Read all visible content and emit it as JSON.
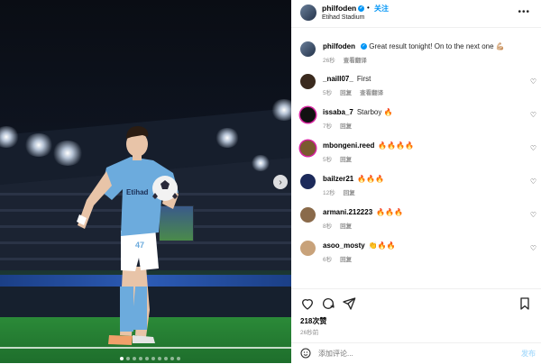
{
  "header": {
    "username": "philfoden",
    "separator": "•",
    "follow_label": "关注",
    "location": "Etihad Stadium",
    "more_icon": "more-dots-icon"
  },
  "caption": {
    "username": "philfoden",
    "text": "Great result tonight! On to the next one 💪🏼",
    "time": "26秒",
    "translate_label": "查看翻译"
  },
  "comments": [
    {
      "username": "_naill07_",
      "text": "First",
      "time": "5秒",
      "reply_label": "回复",
      "translate_label": "查看翻译"
    },
    {
      "username": "issaba_7",
      "text": "Starboy 🔥",
      "time": "7秒",
      "reply_label": "回复"
    },
    {
      "username": "mbongeni.reed",
      "text": "🔥🔥🔥🔥",
      "time": "5秒",
      "reply_label": "回复"
    },
    {
      "username": "bailzer21",
      "text": "🔥🔥🔥",
      "time": "12秒",
      "reply_label": "回复"
    },
    {
      "username": "armani.212223",
      "text": "🔥🔥🔥",
      "time": "8秒",
      "reply_label": "回复"
    },
    {
      "username": "asoo_mosty",
      "text": "👏🔥🔥",
      "time": "6秒",
      "reply_label": "回复"
    }
  ],
  "actions": {
    "likes": "218次赞",
    "time": "26秒前"
  },
  "add_comment": {
    "placeholder": "添加评论...",
    "post_label": "发布"
  },
  "media": {
    "jersey_number": "47",
    "sponsor": "Etihad",
    "carousel_total": 10,
    "carousel_active": 1
  },
  "colors": {
    "accent": "#0095f6",
    "post_disabled": "#b2dffc"
  }
}
